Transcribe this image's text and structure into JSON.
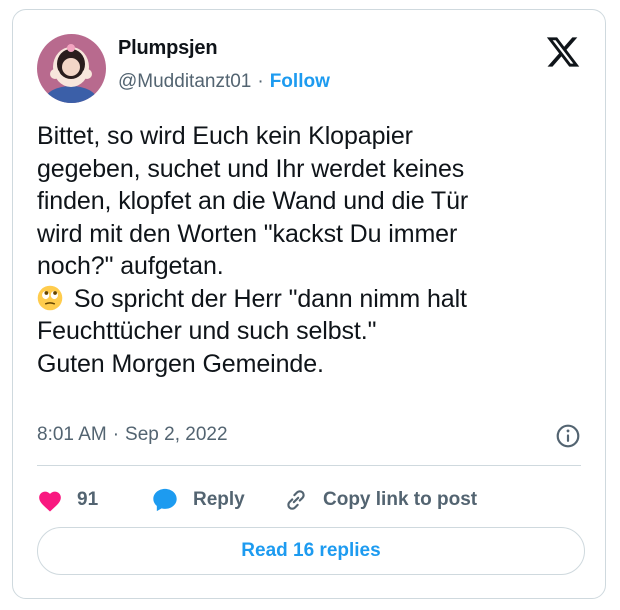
{
  "author": {
    "display_name": "Plumpsjen",
    "handle": "@Mudditanzt01",
    "separator": "·",
    "follow_label": "Follow",
    "avatar_icon": "cartoon-avatar-icon"
  },
  "brand": {
    "logo_icon": "x-logo-icon"
  },
  "tweet": {
    "text_before_emoji": "Bittet, so wird Euch kein Klopapier\ngegeben, suchet und Ihr werdet keines\nfinden, klopfet an die Wand und die Tür\nwird mit den Worten \"kackst Du immer\nnoch?\" aufgetan.\n",
    "emoji_icon": "rolling-eyes-emoji-icon",
    "text_after_emoji": " So spricht der Herr \"dann nimm halt\nFeuchttücher und such selbst.\"\nGuten Morgen Gemeinde."
  },
  "meta": {
    "time": "8:01 AM",
    "separator": "·",
    "date": "Sep 2, 2022",
    "info_icon": "info-icon"
  },
  "actions": {
    "like_count": "91",
    "reply_label": "Reply",
    "copy_label": "Copy link to post"
  },
  "read_replies_label": "Read 16 replies",
  "colors": {
    "accent": "#1d9bf0",
    "like": "#f91880",
    "text": "#0f1419",
    "muted": "#536471",
    "border": "#cfd9de"
  }
}
